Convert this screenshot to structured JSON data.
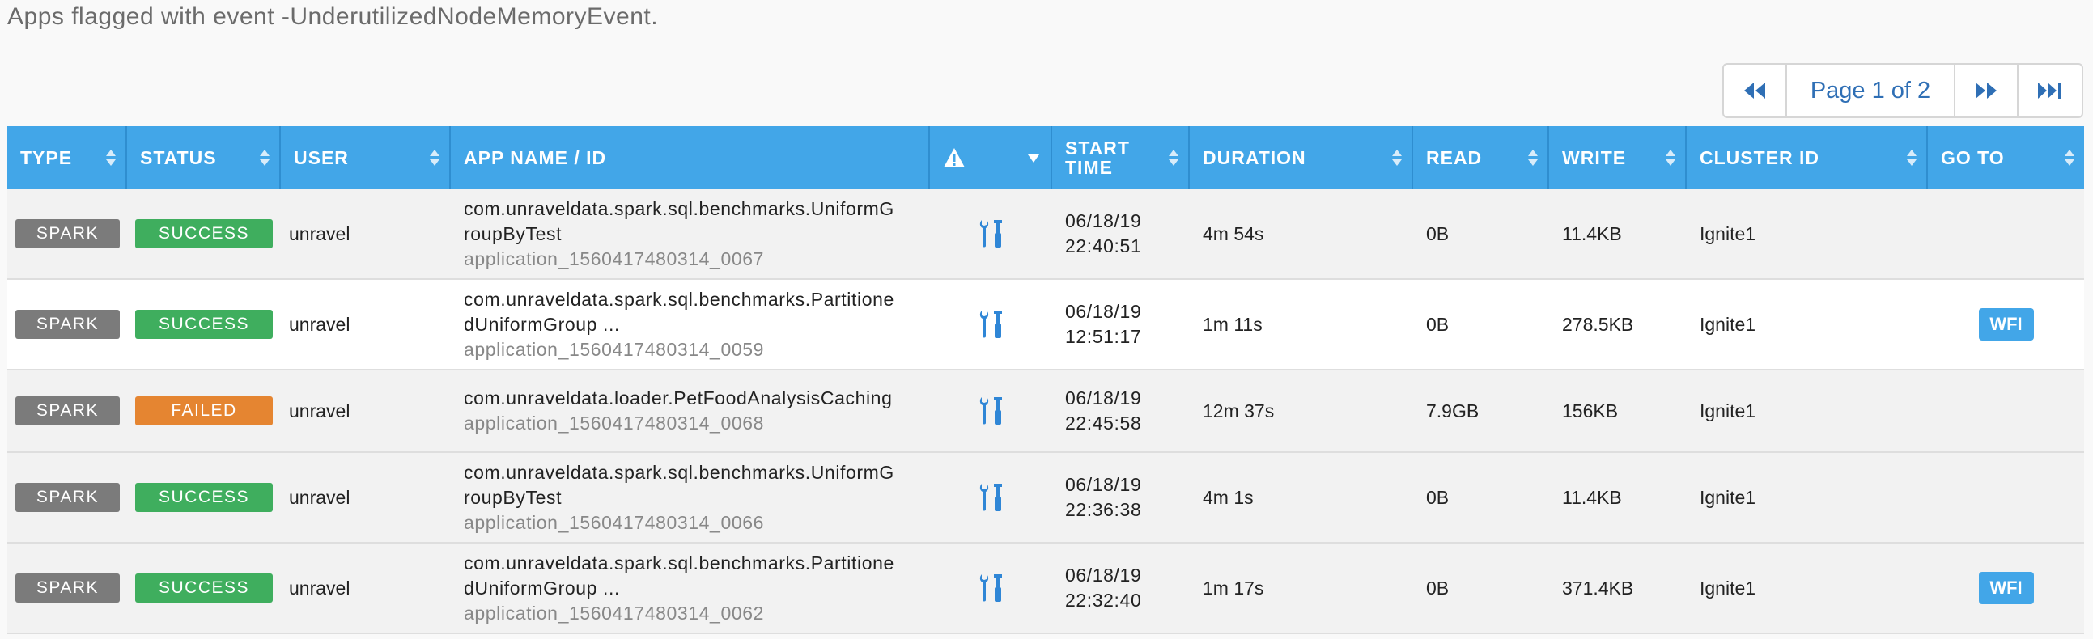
{
  "caption": "Apps flagged with event -UnderutilizedNodeMemoryEvent.",
  "pager": {
    "label": "Page 1 of 2",
    "prev_icon": "double-chevron-left",
    "next_icon": "double-chevron-right",
    "last_icon": "skip-to-end"
  },
  "columns": {
    "type": "TYPE",
    "status": "STATUS",
    "user": "USER",
    "app": "APP NAME / ID",
    "alert_icon": "warning-triangle",
    "start_time_1": "START",
    "start_time_2": "TIME",
    "duration": "DURATION",
    "read": "READ",
    "write": "WRITE",
    "cluster": "CLUSTER ID",
    "goto": "GO TO"
  },
  "colors": {
    "header": "#42a6e8",
    "success": "#3fae5e",
    "failed": "#e58531",
    "type_badge": "#7b7b7b",
    "tools_icon": "#2f86d6"
  },
  "rows": [
    {
      "type": "SPARK",
      "status": "SUCCESS",
      "user": "unravel",
      "name_1": "com.unraveldata.spark.sql.benchmarks.UniformG",
      "name_2": "roupByTest",
      "app_id": "application_1560417480314_0067",
      "date": "06/18/19",
      "time": "22:40:51",
      "duration": "4m 54s",
      "read": "0B",
      "write": "11.4KB",
      "cluster": "Ignite1",
      "goto": ""
    },
    {
      "type": "SPARK",
      "status": "SUCCESS",
      "user": "unravel",
      "name_1": "com.unraveldata.spark.sql.benchmarks.Partitione",
      "name_2": "dUniformGroup ...",
      "app_id": "application_1560417480314_0059",
      "date": "06/18/19",
      "time": "12:51:17",
      "duration": "1m 11s",
      "read": "0B",
      "write": "278.5KB",
      "cluster": "Ignite1",
      "goto": "WFI"
    },
    {
      "type": "SPARK",
      "status": "FAILED",
      "user": "unravel",
      "name_1": "com.unraveldata.loader.PetFoodAnalysisCaching",
      "name_2": "",
      "app_id": "application_1560417480314_0068",
      "date": "06/18/19",
      "time": "22:45:58",
      "duration": "12m 37s",
      "read": "7.9GB",
      "write": "156KB",
      "cluster": "Ignite1",
      "goto": ""
    },
    {
      "type": "SPARK",
      "status": "SUCCESS",
      "user": "unravel",
      "name_1": "com.unraveldata.spark.sql.benchmarks.UniformG",
      "name_2": "roupByTest",
      "app_id": "application_1560417480314_0066",
      "date": "06/18/19",
      "time": "22:36:38",
      "duration": "4m 1s",
      "read": "0B",
      "write": "11.4KB",
      "cluster": "Ignite1",
      "goto": ""
    },
    {
      "type": "SPARK",
      "status": "SUCCESS",
      "user": "unravel",
      "name_1": "com.unraveldata.spark.sql.benchmarks.Partitione",
      "name_2": "dUniformGroup ...",
      "app_id": "application_1560417480314_0062",
      "date": "06/18/19",
      "time": "22:32:40",
      "duration": "1m 17s",
      "read": "0B",
      "write": "371.4KB",
      "cluster": "Ignite1",
      "goto": "WFI"
    }
  ]
}
